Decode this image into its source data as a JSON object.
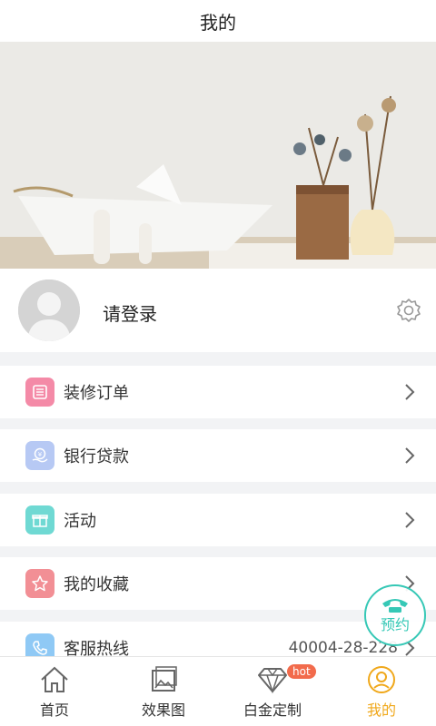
{
  "header": {
    "title": "我的"
  },
  "profile": {
    "login_text": "请登录"
  },
  "menu": {
    "items": [
      {
        "label": "装修订单",
        "icon": "order-list-icon",
        "color": "#f48aa7"
      },
      {
        "label": "银行贷款",
        "icon": "loan-coin-icon",
        "color": "#b7c9f4"
      },
      {
        "label": "活动",
        "icon": "gift-icon",
        "color": "#6fd9d3"
      },
      {
        "label": "我的收藏",
        "icon": "star-icon",
        "color": "#f28f95"
      },
      {
        "label": "客服热线",
        "icon": "phone-icon",
        "color": "#8fc9f5",
        "value": "40004-28-228"
      }
    ]
  },
  "fab": {
    "label": "预约",
    "color": "#36c8b6"
  },
  "tabbar": {
    "tabs": [
      {
        "label": "首页",
        "icon": "home-icon"
      },
      {
        "label": "效果图",
        "icon": "gallery-icon"
      },
      {
        "label": "白金定制",
        "icon": "diamond-icon",
        "badge": "hot"
      },
      {
        "label": "我的",
        "icon": "user-icon",
        "active": true
      }
    ],
    "accent": "#f0a81b"
  }
}
